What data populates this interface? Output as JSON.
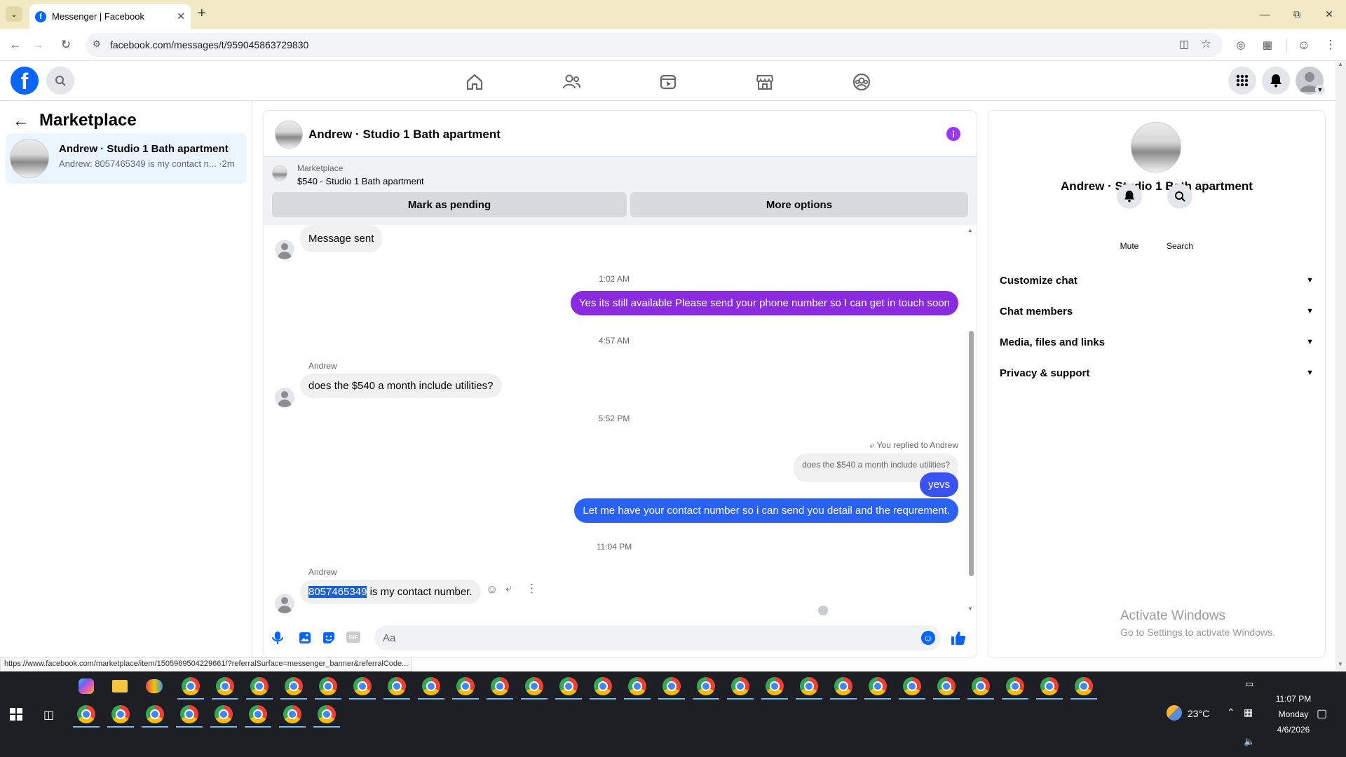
{
  "browser": {
    "tab_title": "Messenger | Facebook",
    "url": "facebook.com/messages/t/959045863729830",
    "new_tab": "+",
    "status_url": "https://www.facebook.com/marketplace/item/1505969504229661/?referralSurface=messenger_banner&referralCode..."
  },
  "fb_header": {
    "logo": "f",
    "nav": [
      "home-icon",
      "friends-icon",
      "video-icon",
      "marketplace-icon",
      "groups-icon"
    ]
  },
  "left_panel": {
    "title": "Marketplace",
    "conversations": [
      {
        "name": "Andrew · Studio 1 Bath apartment",
        "preview": "Andrew: 8057465349 is my contact n... ·2m"
      }
    ]
  },
  "chat": {
    "title": "Andrew · Studio 1 Bath apartment",
    "banner": {
      "source": "Marketplace",
      "listing": "$540 - Studio 1 Bath apartment",
      "mark_pending": "Mark as pending",
      "more_options": "More options"
    },
    "messages": {
      "m1": "Message sent",
      "t1": "1:02 AM",
      "m2": "Yes its still available Please send your phone number so I can get in touch soon",
      "t2": "4:57 AM",
      "sender1": "Andrew",
      "m3": "does the $540 a month include utilities?",
      "t3": "5:52 PM",
      "reply_label": "You replied to Andrew",
      "quoted": "does the $540 a month include utilities?",
      "m4": "yevs",
      "m5": "Let me have your contact number so i can send you detail and the requrement.",
      "t4": "11:04 PM",
      "sender2": "Andrew",
      "m6_highlight": "8057465349",
      "m6_rest": " is my contact number."
    },
    "composer_placeholder": "Aa"
  },
  "right_panel": {
    "name": "Andrew · Studio 1 Bath apartment",
    "mute": "Mute",
    "search": "Search",
    "sections": [
      "Customize chat",
      "Chat members",
      "Media, files and links",
      "Privacy & support"
    ]
  },
  "watermark": {
    "line1": "Activate Windows",
    "line2": "Go to Settings to activate Windows."
  },
  "taskbar": {
    "temperature": "23°C",
    "time": "11:07 PM",
    "day": "Monday",
    "date": "4/6/2026"
  },
  "colors": {
    "accent_blue": "#0866ff",
    "outgoing_purple": "#8a2be2",
    "outgoing_blue": "#2a62f5",
    "info_purple": "#a033ff",
    "selection": "#1e5fce"
  }
}
